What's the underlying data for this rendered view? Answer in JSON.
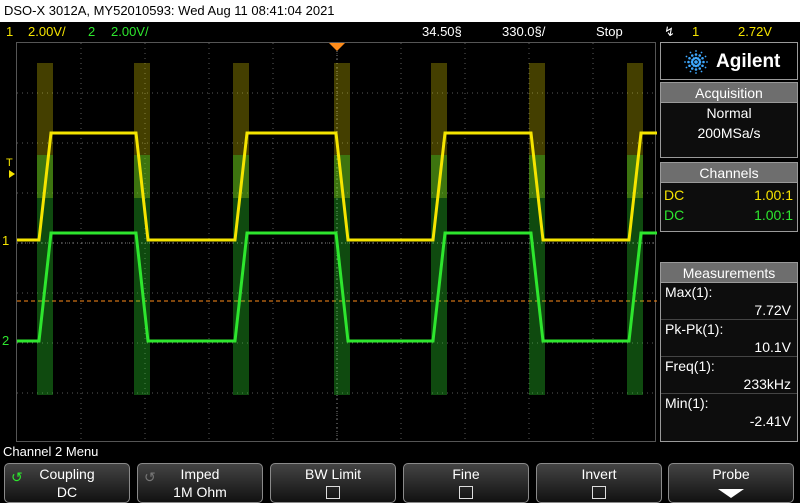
{
  "title_bar": {
    "text": "DSO-X 3012A, MY52010593: Wed Aug 11 08:41:04 2021"
  },
  "status_bar": {
    "ch1_num": "1",
    "ch1_scale": "2.00V/",
    "ch2_num": "2",
    "ch2_scale": "2.00V/",
    "timebase_pos": "34.50§",
    "timebase_scale": "330.0§/",
    "run_state": "Stop",
    "trigger_icon": "trigger-edge-icon",
    "trigger_source": "1",
    "trigger_level": "2.72V"
  },
  "screen": {
    "trigger_marker": "T",
    "ch1_marker": "1",
    "ch2_marker": "2"
  },
  "brand": {
    "name": "Agilent",
    "logo_icon": "agilent-spark-icon"
  },
  "acquisition": {
    "header": "Acquisition",
    "mode": "Normal",
    "rate": "200MSa/s"
  },
  "channels": {
    "header": "Channels",
    "rows": [
      {
        "coupling": "DC",
        "probe": "1.00:1",
        "color": "#f5e400"
      },
      {
        "coupling": "DC",
        "probe": "1.00:1",
        "color": "#2ee62e"
      }
    ]
  },
  "measurements": {
    "header": "Measurements",
    "items": [
      {
        "name": "Max(1):",
        "value": "7.72V"
      },
      {
        "name": "Pk-Pk(1):",
        "value": "10.1V"
      },
      {
        "name": "Freq(1):",
        "value": "233kHz"
      },
      {
        "name": "Min(1):",
        "value": "-2.41V"
      }
    ]
  },
  "menu": {
    "title": "Channel 2 Menu",
    "softkeys": [
      {
        "label": "Coupling",
        "value": "DC",
        "icon": "knob-icon"
      },
      {
        "label": "Imped",
        "value": "1M Ohm",
        "icon": "knob-icon"
      },
      {
        "label": "BW Limit",
        "value": "",
        "icon": "checkbox-icon"
      },
      {
        "label": "Fine",
        "value": "",
        "icon": "checkbox-icon"
      },
      {
        "label": "Invert",
        "value": "",
        "icon": "checkbox-icon"
      },
      {
        "label": "Probe",
        "value": "",
        "icon": "down-arrow-icon"
      }
    ]
  },
  "colors": {
    "ch1": "#f5e400",
    "ch2": "#2ee62e",
    "trigger": "#ff8c1a",
    "panel_header": "#6e6e6e",
    "grid": "#5a5a5a"
  }
}
